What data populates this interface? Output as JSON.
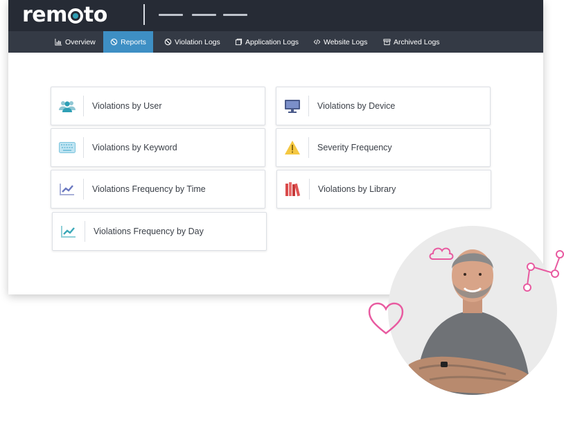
{
  "brand": {
    "logo_prefix": "rem",
    "logo_suffix": "to",
    "accent": "#2f9fb5"
  },
  "nav": {
    "items": [
      {
        "label": "Overview",
        "icon": "bar-chart-icon",
        "active": false
      },
      {
        "label": "Reports",
        "icon": "ban-icon",
        "active": true
      },
      {
        "label": "Violation Logs",
        "icon": "ban-icon",
        "active": false
      },
      {
        "label": "Application Logs",
        "icon": "window-icon",
        "active": false
      },
      {
        "label": "Website Logs",
        "icon": "code-icon",
        "active": false
      },
      {
        "label": "Archived Logs",
        "icon": "archive-icon",
        "active": false
      }
    ],
    "active_color": "#3e8fc4"
  },
  "reports": [
    {
      "label": "Violations by User",
      "icon": "users-icon"
    },
    {
      "label": "Violations by Device",
      "icon": "monitor-icon"
    },
    {
      "label": "Violations by Keyword",
      "icon": "keyboard-icon"
    },
    {
      "label": "Severity Frequency",
      "icon": "warning-icon"
    },
    {
      "label": "Violations Frequency by Time",
      "icon": "trend-chart-icon"
    },
    {
      "label": "Violations by Library",
      "icon": "books-icon"
    },
    {
      "label": "Violations Frequency by Day",
      "icon": "trend-chart-icon"
    }
  ]
}
